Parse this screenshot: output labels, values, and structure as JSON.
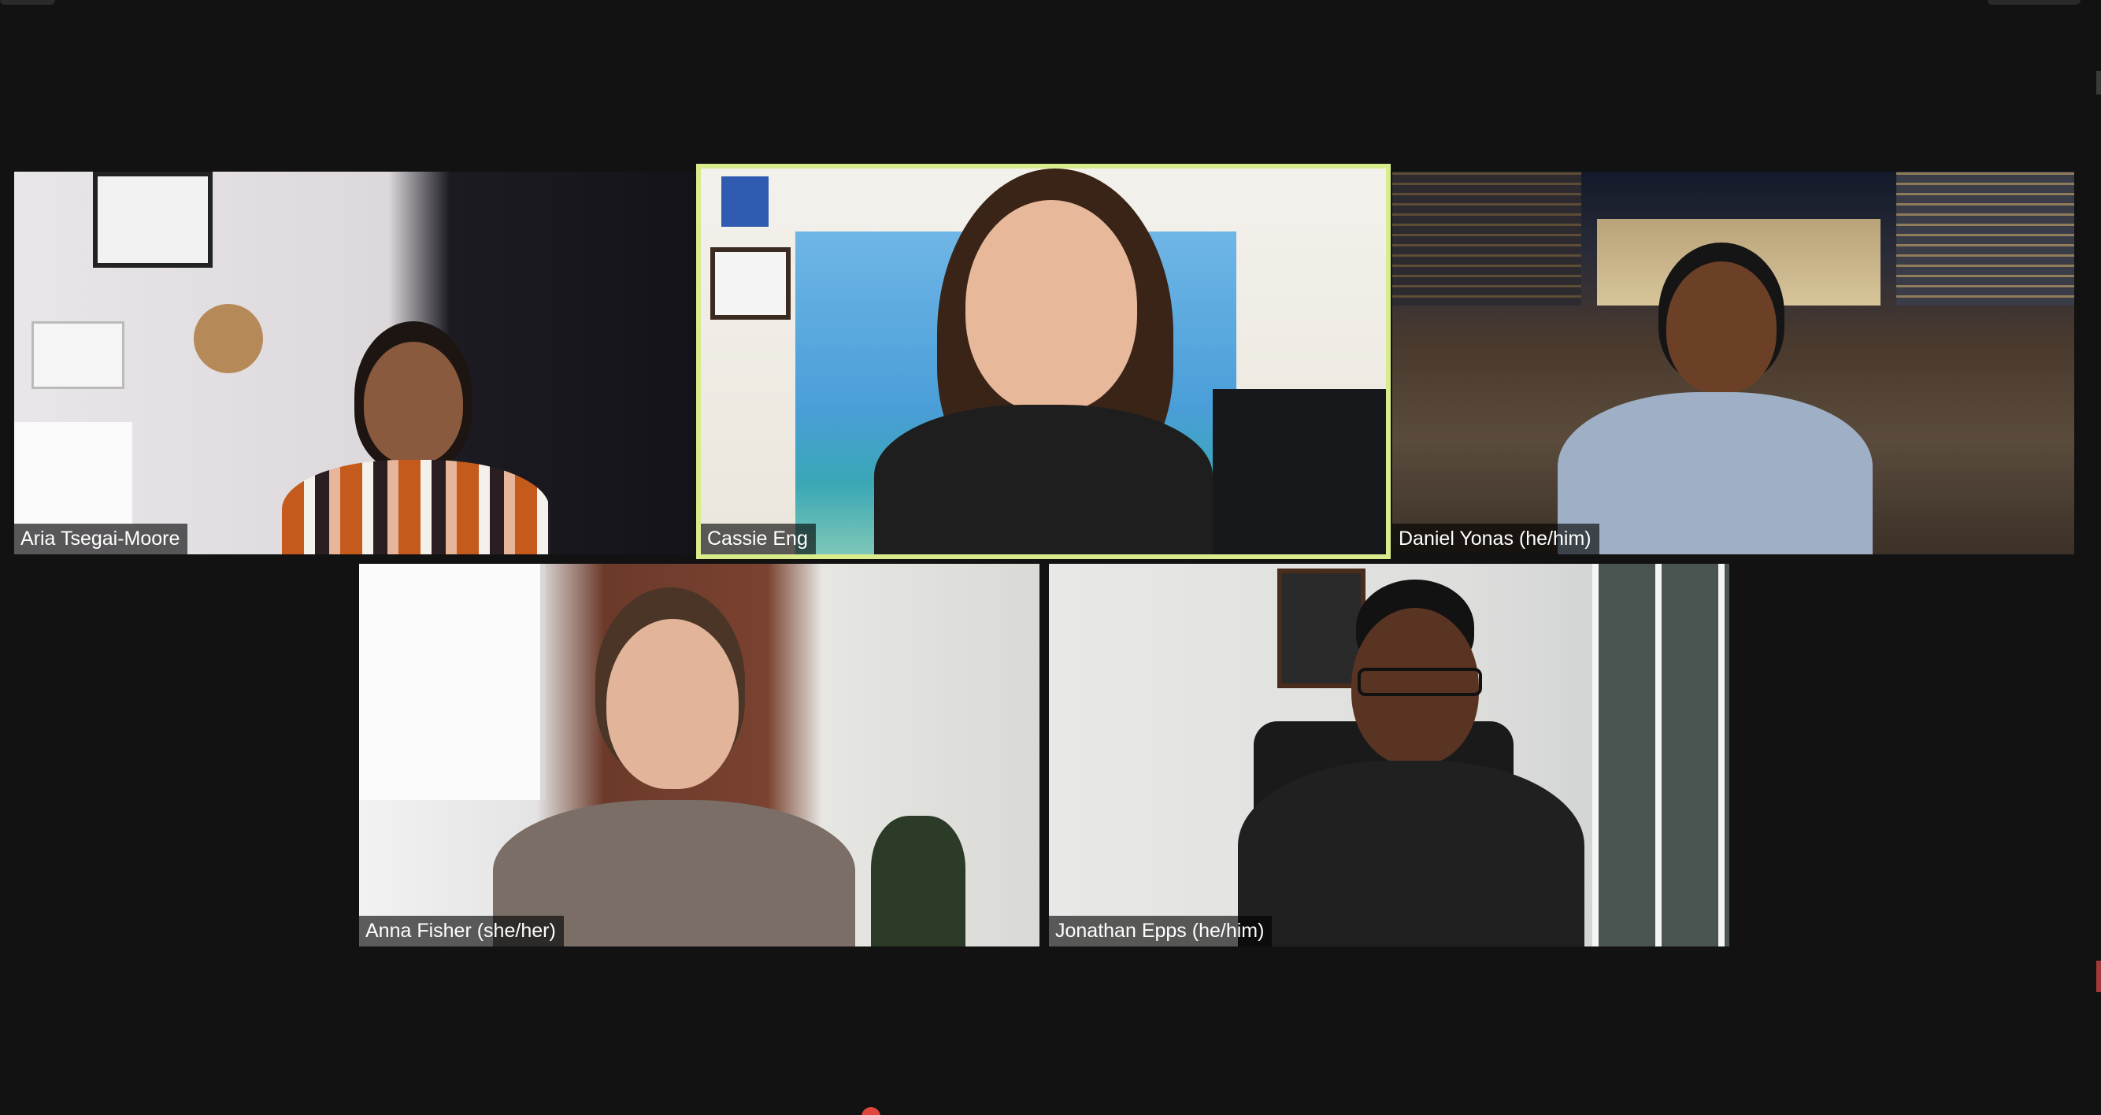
{
  "meeting": {
    "participants": [
      {
        "name": "Aria Tsegai-Moore",
        "active": false
      },
      {
        "name": "Cassie Eng",
        "active": true
      },
      {
        "name": "Daniel Yonas (he/him)",
        "active": false
      },
      {
        "name": "Anna Fisher (she/her)",
        "active": false
      },
      {
        "name": "Jonathan Epps (he/him)",
        "active": false
      }
    ]
  },
  "colors": {
    "background": "#121212",
    "active_speaker_border": "#d9ec8c",
    "name_tag_bg": "rgba(0,0,0,0.62)",
    "notification": "#e0463c"
  }
}
